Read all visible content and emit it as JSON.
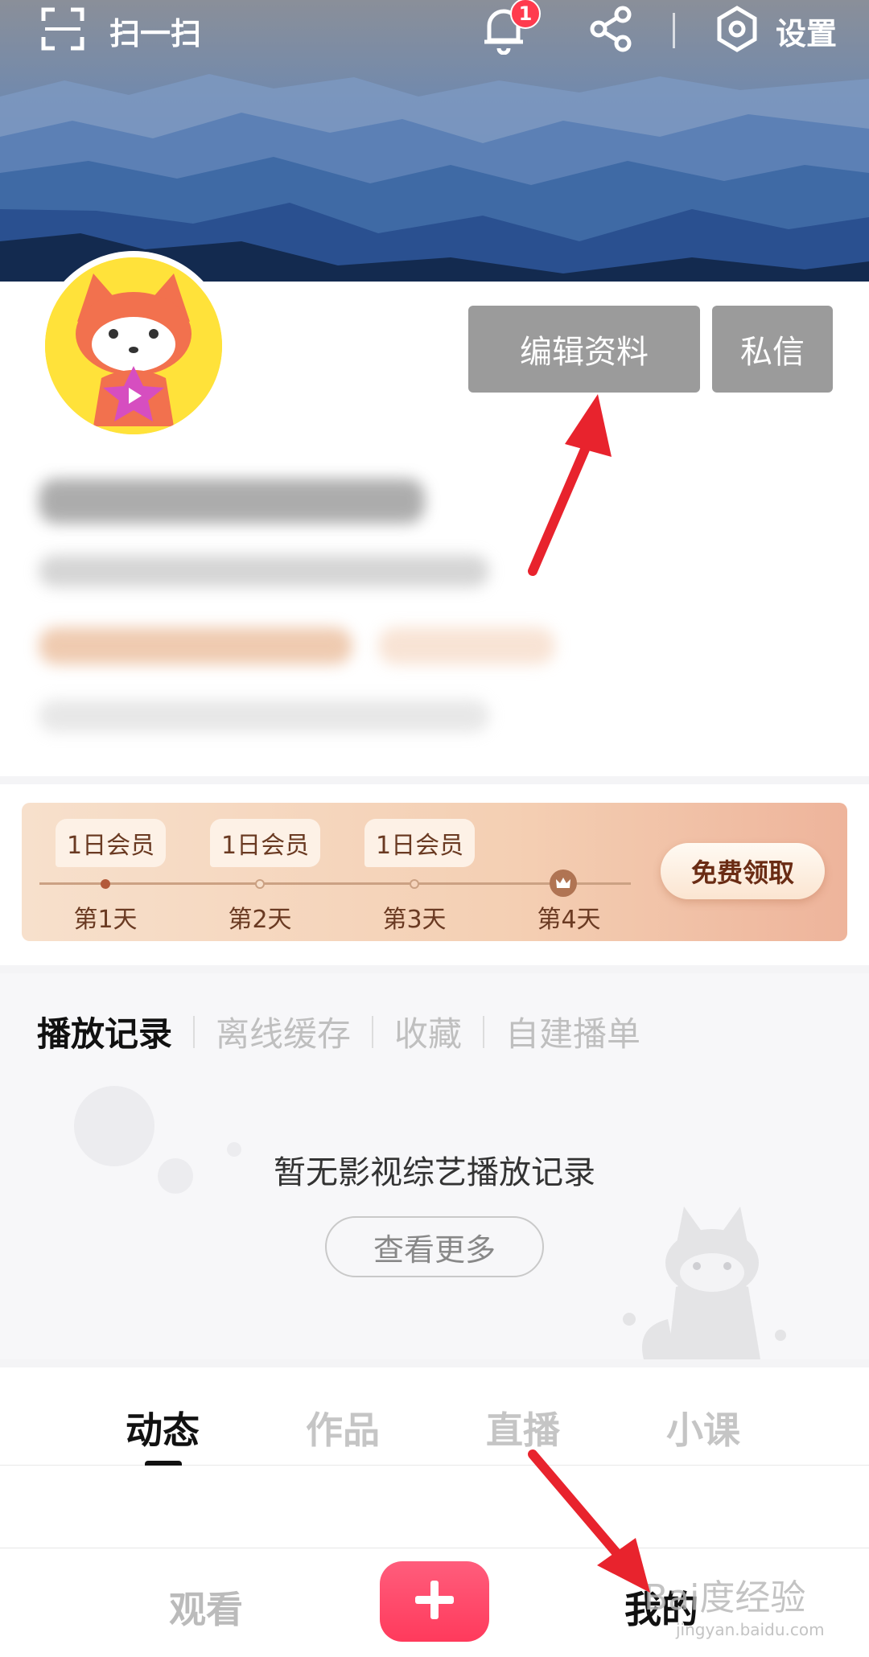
{
  "topbar": {
    "scan_label": "扫一扫",
    "notification_count": "1",
    "settings_label": "设置"
  },
  "profile": {
    "edit_label": "编辑资料",
    "message_label": "私信"
  },
  "member": {
    "days": [
      {
        "tag": "1日会员",
        "label": "第1天"
      },
      {
        "tag": "1日会员",
        "label": "第2天"
      },
      {
        "tag": "1日会员",
        "label": "第3天"
      },
      {
        "tag": "",
        "label": "第4天"
      }
    ],
    "claim_label": "免费领取"
  },
  "history": {
    "tabs": [
      "播放记录",
      "离线缓存",
      "收藏",
      "自建播单"
    ],
    "empty_message": "暂无影视综艺播放记录",
    "more_label": "查看更多"
  },
  "content_tabs": [
    "动态",
    "作品",
    "直播",
    "小课"
  ],
  "bottom_nav": {
    "watch_label": "观看",
    "mine_label": "我的"
  },
  "watermark": {
    "brand": "Bai度经验",
    "url": "jingyan.baidu.com"
  },
  "colors": {
    "accent": "#ff3a5c",
    "annotation_arrow": "#e8232d",
    "button_gray": "#9b9b9b"
  }
}
